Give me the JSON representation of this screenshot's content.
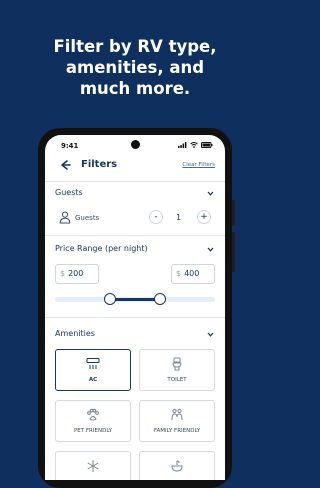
{
  "headline": {
    "line1": "Filter by RV type,",
    "line2": "amenities, and",
    "line3": "much more."
  },
  "status_bar": {
    "time": "9:41"
  },
  "header": {
    "title": "Filters",
    "clear_label": "Clear Filters"
  },
  "guests": {
    "section_label": "Guests",
    "row_label": "Guests",
    "count": "1",
    "minus": "-",
    "plus": "+"
  },
  "price": {
    "section_label": "Price Range (per night)",
    "currency": "$",
    "min": "200",
    "max": "400"
  },
  "amenities": {
    "section_label": "Amenities",
    "items": [
      {
        "label": "AC",
        "icon": "ac-unit-icon",
        "selected": true
      },
      {
        "label": "TOILET",
        "icon": "toilet-icon",
        "selected": false
      },
      {
        "label": "PET FRIENDLY",
        "icon": "paw-icon",
        "selected": false
      },
      {
        "label": "FAMILY FRIENDLY",
        "icon": "family-icon",
        "selected": false
      },
      {
        "label": "",
        "icon": "snowflake-icon",
        "selected": false
      },
      {
        "label": "",
        "icon": "sink-icon",
        "selected": false
      }
    ]
  },
  "colors": {
    "background": "#0f2f5f",
    "brand_navy": "#173764",
    "slider_track": "#e4eefb"
  }
}
